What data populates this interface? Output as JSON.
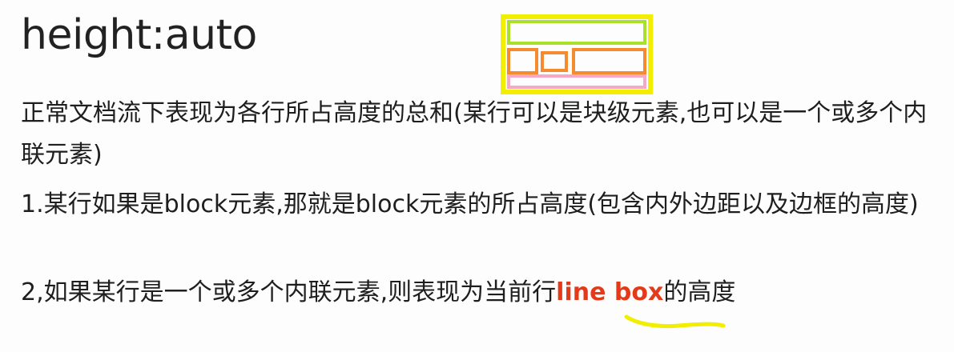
{
  "title": "height:auto",
  "paragraphs": {
    "p1": "正常文档流下表现为各行所占高度的总和(某行可以是块级元素,也可以是一个或多个内联元素)",
    "p2": "1.某行如果是block元素,那就是block元素的所占高度(包含内外边距以及边框的高度)",
    "p3_prefix": "2,如果某行是一个或多个内联元素,则表现为当前行",
    "p3_highlight": "line box",
    "p3_suffix": "的高度"
  },
  "colors": {
    "outer_box": "#f2ee00",
    "block_line": "#a8e02a",
    "inline_boxes": "#f58a2e",
    "bottom_line": "#f7a8c4",
    "highlight_text": "#e53a1a",
    "underline_mark": "#f2ee00"
  }
}
